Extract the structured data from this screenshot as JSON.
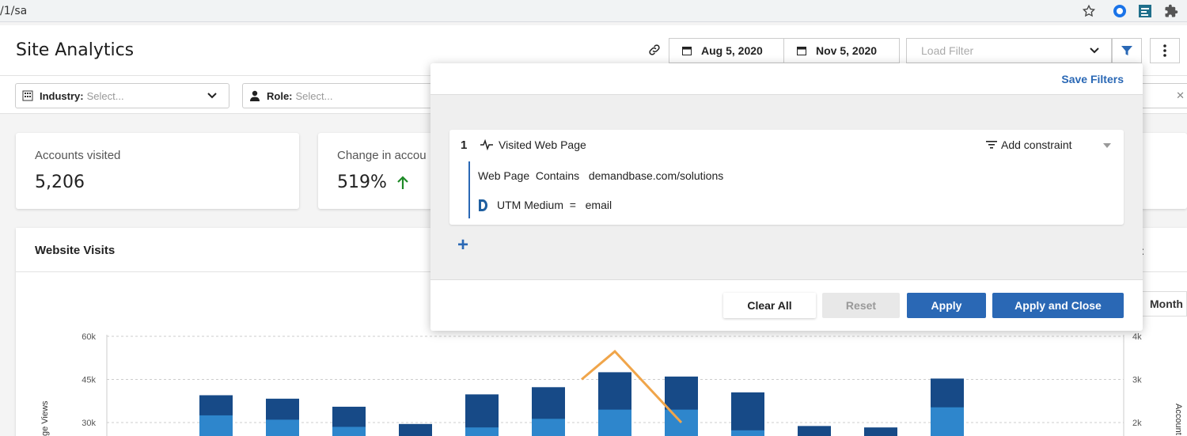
{
  "browser": {
    "url": "/1/sa",
    "icons": [
      "star-icon",
      "extension-circle-icon",
      "extension-sheet-icon",
      "puzzle-icon"
    ]
  },
  "header": {
    "title": "Site Analytics",
    "start_date": "Aug 5, 2020",
    "end_date": "Nov 5, 2020",
    "load_filter_placeholder": "Load Filter"
  },
  "filters": {
    "industry_label": "Industry:",
    "industry_placeholder": "Select...",
    "role_label": "Role:",
    "role_placeholder": "Select..."
  },
  "cards": [
    {
      "label": "Accounts visited",
      "value": "5,206"
    },
    {
      "label": "Change in accou",
      "value": "519%"
    }
  ],
  "chart": {
    "title": "Website Visits",
    "right_button_partial": "rt",
    "month_button": "Month",
    "left_axis_label": "ge Views",
    "right_axis_label": "Account",
    "colors": {
      "dark_bar": "#174a87",
      "light_bar": "#2e86cc",
      "line": "#f0a54a"
    }
  },
  "chart_data": {
    "type": "bar",
    "ylim_left": [
      0,
      60000
    ],
    "ylim_right": [
      0,
      4000
    ],
    "left_ticks": [
      "60k",
      "45k",
      "30k"
    ],
    "right_ticks": [
      "4k",
      "3k",
      "2k"
    ],
    "series": [
      {
        "name": "bar_total",
        "values": [
          39500,
          38300,
          35500,
          29500,
          39800,
          42300,
          47500,
          46000,
          40500,
          28800,
          28300,
          45300
        ]
      },
      {
        "name": "bar_lower",
        "values": [
          32500,
          31000,
          28500,
          0,
          28300,
          31300,
          34500,
          34500,
          27300,
          0,
          0,
          35300
        ]
      }
    ],
    "line_points": [
      {
        "index": 5.5,
        "value": 3000
      },
      {
        "index": 6,
        "value": 3650
      },
      {
        "index": 7,
        "value": 2000
      }
    ]
  },
  "panel": {
    "save_filters": "Save Filters",
    "rule": {
      "number": "1",
      "name": "Visited Web Page",
      "add_constraint": "Add constraint",
      "condition1": "Web Page  Contains   demandbase.com/solutions",
      "condition2": "UTM Medium  =   email"
    },
    "add": "+",
    "buttons": {
      "clear_all": "Clear All",
      "reset": "Reset",
      "apply": "Apply",
      "apply_close": "Apply and Close"
    }
  }
}
